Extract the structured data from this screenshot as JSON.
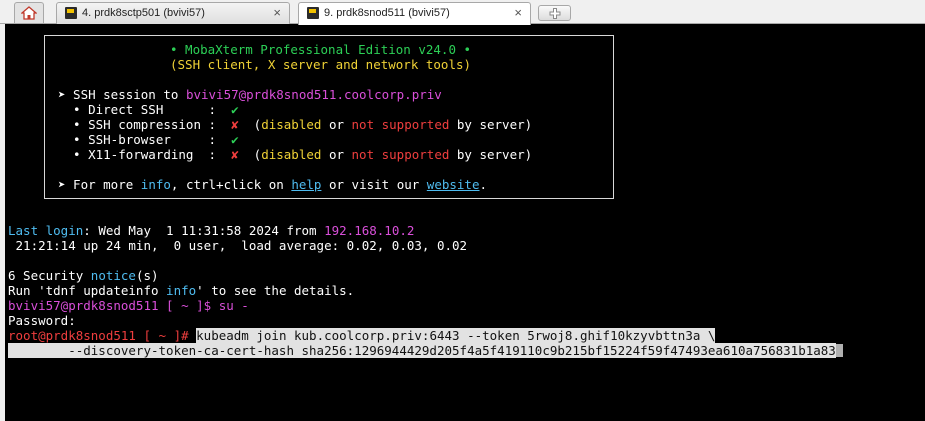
{
  "tabs": {
    "home_icon": "home-icon",
    "items": [
      {
        "label": "4. prdk8sctp501 (bvivi57)",
        "icon": "terminal-key-icon",
        "close": "×"
      },
      {
        "label": "9. prdk8snod511 (bvivi57)",
        "icon": "terminal-key-icon",
        "close": "×"
      }
    ],
    "new_tab_icon": "plus-icon"
  },
  "banner": {
    "title": "• MobaXterm Professional Edition v24.0 •",
    "subtitle": "(SSH client, X server and network tools)",
    "ssh_prefix": "➤ SSH session to ",
    "ssh_target": "bvivi57@prdk8snod511.coolcorp.priv",
    "direct_ssh_label": "  • Direct SSH      :  ",
    "check": "✔",
    "cross": "✘",
    "compression_label": "  • SSH compression :  ",
    "browser_label": "  • SSH-browser     :  ",
    "x11_label": "  • X11-forwarding  :  ",
    "paren_open": "  (",
    "disabled": "disabled",
    "or": " or ",
    "not_supported": "not supported",
    "by_server": " by server)",
    "more_prefix": "➤ For more ",
    "info": "info",
    "more_mid": ", ctrl+click on ",
    "help": "help",
    "more_mid2": " or visit our ",
    "website": "website",
    "period": "."
  },
  "session": {
    "last_login_label": "Last login",
    "last_login_text": ": Wed May  1 11:31:58 2024 from ",
    "last_login_ip": "192.168.10.2",
    "uptime_line": " 21:21:14 up 24 min,  0 user,  load average: 0.02, 0.03, 0.02",
    "security_prefix": "6 Security ",
    "security_notice": "notice",
    "security_suffix": "(s)",
    "run_prefix": "Run 'tdnf updateinfo ",
    "run_info": "info",
    "run_suffix": "' to see the details.",
    "user_prompt": "bvivi57@prdk8snod511 [ ~ ]$ su -",
    "password_prompt": "Password:",
    "root_prompt": "root@prdk8snod511 [ ~ ]# ",
    "command_line1": "kubeadm join kub.coolcorp.priv:6443 --token 5rwoj8.ghif10kzyvbttn3a \\",
    "command_line2": "        --discovery-token-ca-cert-hash sha256:1296944429d205f4a5f419110c9b215bf15224f59f47493ea610a756831b1a83"
  },
  "colors": {
    "green": "#2ccf56",
    "yellow": "#f0d236",
    "magenta": "#d94fd9",
    "red": "#ef3e3e",
    "cyan": "#4fbcf0",
    "selection": "#e2e2e2"
  }
}
